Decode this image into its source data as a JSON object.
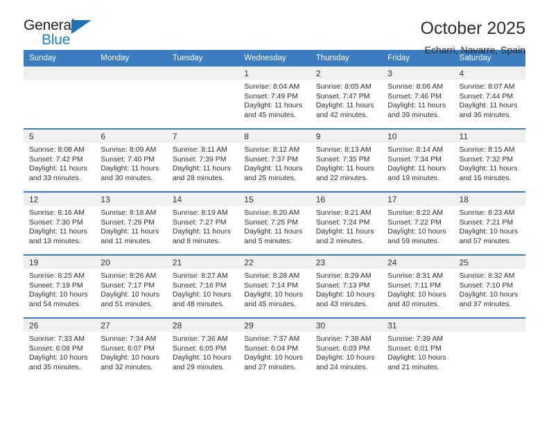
{
  "brand": {
    "word_one": "General",
    "word_two": "Blue",
    "triangle_color": "#1d72b8",
    "blue_text_color": "#1d7ec4"
  },
  "header": {
    "title": "October 2025",
    "subtitle": "Echarri, Navarre, Spain",
    "header_bg": "#3b7dbf",
    "daynum_bg": "#f0f0f0"
  },
  "weekday_headers": [
    "Sunday",
    "Monday",
    "Tuesday",
    "Wednesday",
    "Thursday",
    "Friday",
    "Saturday"
  ],
  "weeks": [
    [
      {
        "day": "",
        "sunrise": "",
        "sunset": "",
        "daylight_line1": "",
        "daylight_line2": ""
      },
      {
        "day": "",
        "sunrise": "",
        "sunset": "",
        "daylight_line1": "",
        "daylight_line2": ""
      },
      {
        "day": "",
        "sunrise": "",
        "sunset": "",
        "daylight_line1": "",
        "daylight_line2": ""
      },
      {
        "day": "1",
        "sunrise": "Sunrise: 8:04 AM",
        "sunset": "Sunset: 7:49 PM",
        "daylight_line1": "Daylight: 11 hours",
        "daylight_line2": "and 45 minutes."
      },
      {
        "day": "2",
        "sunrise": "Sunrise: 8:05 AM",
        "sunset": "Sunset: 7:47 PM",
        "daylight_line1": "Daylight: 11 hours",
        "daylight_line2": "and 42 minutes."
      },
      {
        "day": "3",
        "sunrise": "Sunrise: 8:06 AM",
        "sunset": "Sunset: 7:46 PM",
        "daylight_line1": "Daylight: 11 hours",
        "daylight_line2": "and 39 minutes."
      },
      {
        "day": "4",
        "sunrise": "Sunrise: 8:07 AM",
        "sunset": "Sunset: 7:44 PM",
        "daylight_line1": "Daylight: 11 hours",
        "daylight_line2": "and 36 minutes."
      }
    ],
    [
      {
        "day": "5",
        "sunrise": "Sunrise: 8:08 AM",
        "sunset": "Sunset: 7:42 PM",
        "daylight_line1": "Daylight: 11 hours",
        "daylight_line2": "and 33 minutes."
      },
      {
        "day": "6",
        "sunrise": "Sunrise: 8:09 AM",
        "sunset": "Sunset: 7:40 PM",
        "daylight_line1": "Daylight: 11 hours",
        "daylight_line2": "and 30 minutes."
      },
      {
        "day": "7",
        "sunrise": "Sunrise: 8:11 AM",
        "sunset": "Sunset: 7:39 PM",
        "daylight_line1": "Daylight: 11 hours",
        "daylight_line2": "and 28 minutes."
      },
      {
        "day": "8",
        "sunrise": "Sunrise: 8:12 AM",
        "sunset": "Sunset: 7:37 PM",
        "daylight_line1": "Daylight: 11 hours",
        "daylight_line2": "and 25 minutes."
      },
      {
        "day": "9",
        "sunrise": "Sunrise: 8:13 AM",
        "sunset": "Sunset: 7:35 PM",
        "daylight_line1": "Daylight: 11 hours",
        "daylight_line2": "and 22 minutes."
      },
      {
        "day": "10",
        "sunrise": "Sunrise: 8:14 AM",
        "sunset": "Sunset: 7:34 PM",
        "daylight_line1": "Daylight: 11 hours",
        "daylight_line2": "and 19 minutes."
      },
      {
        "day": "11",
        "sunrise": "Sunrise: 8:15 AM",
        "sunset": "Sunset: 7:32 PM",
        "daylight_line1": "Daylight: 11 hours",
        "daylight_line2": "and 16 minutes."
      }
    ],
    [
      {
        "day": "12",
        "sunrise": "Sunrise: 8:16 AM",
        "sunset": "Sunset: 7:30 PM",
        "daylight_line1": "Daylight: 11 hours",
        "daylight_line2": "and 13 minutes."
      },
      {
        "day": "13",
        "sunrise": "Sunrise: 8:18 AM",
        "sunset": "Sunset: 7:29 PM",
        "daylight_line1": "Daylight: 11 hours",
        "daylight_line2": "and 11 minutes."
      },
      {
        "day": "14",
        "sunrise": "Sunrise: 8:19 AM",
        "sunset": "Sunset: 7:27 PM",
        "daylight_line1": "Daylight: 11 hours",
        "daylight_line2": "and 8 minutes."
      },
      {
        "day": "15",
        "sunrise": "Sunrise: 8:20 AM",
        "sunset": "Sunset: 7:25 PM",
        "daylight_line1": "Daylight: 11 hours",
        "daylight_line2": "and 5 minutes."
      },
      {
        "day": "16",
        "sunrise": "Sunrise: 8:21 AM",
        "sunset": "Sunset: 7:24 PM",
        "daylight_line1": "Daylight: 11 hours",
        "daylight_line2": "and 2 minutes."
      },
      {
        "day": "17",
        "sunrise": "Sunrise: 8:22 AM",
        "sunset": "Sunset: 7:22 PM",
        "daylight_line1": "Daylight: 10 hours",
        "daylight_line2": "and 59 minutes."
      },
      {
        "day": "18",
        "sunrise": "Sunrise: 8:23 AM",
        "sunset": "Sunset: 7:21 PM",
        "daylight_line1": "Daylight: 10 hours",
        "daylight_line2": "and 57 minutes."
      }
    ],
    [
      {
        "day": "19",
        "sunrise": "Sunrise: 8:25 AM",
        "sunset": "Sunset: 7:19 PM",
        "daylight_line1": "Daylight: 10 hours",
        "daylight_line2": "and 54 minutes."
      },
      {
        "day": "20",
        "sunrise": "Sunrise: 8:26 AM",
        "sunset": "Sunset: 7:17 PM",
        "daylight_line1": "Daylight: 10 hours",
        "daylight_line2": "and 51 minutes."
      },
      {
        "day": "21",
        "sunrise": "Sunrise: 8:27 AM",
        "sunset": "Sunset: 7:16 PM",
        "daylight_line1": "Daylight: 10 hours",
        "daylight_line2": "and 48 minutes."
      },
      {
        "day": "22",
        "sunrise": "Sunrise: 8:28 AM",
        "sunset": "Sunset: 7:14 PM",
        "daylight_line1": "Daylight: 10 hours",
        "daylight_line2": "and 45 minutes."
      },
      {
        "day": "23",
        "sunrise": "Sunrise: 8:29 AM",
        "sunset": "Sunset: 7:13 PM",
        "daylight_line1": "Daylight: 10 hours",
        "daylight_line2": "and 43 minutes."
      },
      {
        "day": "24",
        "sunrise": "Sunrise: 8:31 AM",
        "sunset": "Sunset: 7:11 PM",
        "daylight_line1": "Daylight: 10 hours",
        "daylight_line2": "and 40 minutes."
      },
      {
        "day": "25",
        "sunrise": "Sunrise: 8:32 AM",
        "sunset": "Sunset: 7:10 PM",
        "daylight_line1": "Daylight: 10 hours",
        "daylight_line2": "and 37 minutes."
      }
    ],
    [
      {
        "day": "26",
        "sunrise": "Sunrise: 7:33 AM",
        "sunset": "Sunset: 6:08 PM",
        "daylight_line1": "Daylight: 10 hours",
        "daylight_line2": "and 35 minutes."
      },
      {
        "day": "27",
        "sunrise": "Sunrise: 7:34 AM",
        "sunset": "Sunset: 6:07 PM",
        "daylight_line1": "Daylight: 10 hours",
        "daylight_line2": "and 32 minutes."
      },
      {
        "day": "28",
        "sunrise": "Sunrise: 7:36 AM",
        "sunset": "Sunset: 6:05 PM",
        "daylight_line1": "Daylight: 10 hours",
        "daylight_line2": "and 29 minutes."
      },
      {
        "day": "29",
        "sunrise": "Sunrise: 7:37 AM",
        "sunset": "Sunset: 6:04 PM",
        "daylight_line1": "Daylight: 10 hours",
        "daylight_line2": "and 27 minutes."
      },
      {
        "day": "30",
        "sunrise": "Sunrise: 7:38 AM",
        "sunset": "Sunset: 6:03 PM",
        "daylight_line1": "Daylight: 10 hours",
        "daylight_line2": "and 24 minutes."
      },
      {
        "day": "31",
        "sunrise": "Sunrise: 7:39 AM",
        "sunset": "Sunset: 6:01 PM",
        "daylight_line1": "Daylight: 10 hours",
        "daylight_line2": "and 21 minutes."
      },
      {
        "day": "",
        "sunrise": "",
        "sunset": "",
        "daylight_line1": "",
        "daylight_line2": ""
      }
    ]
  ]
}
